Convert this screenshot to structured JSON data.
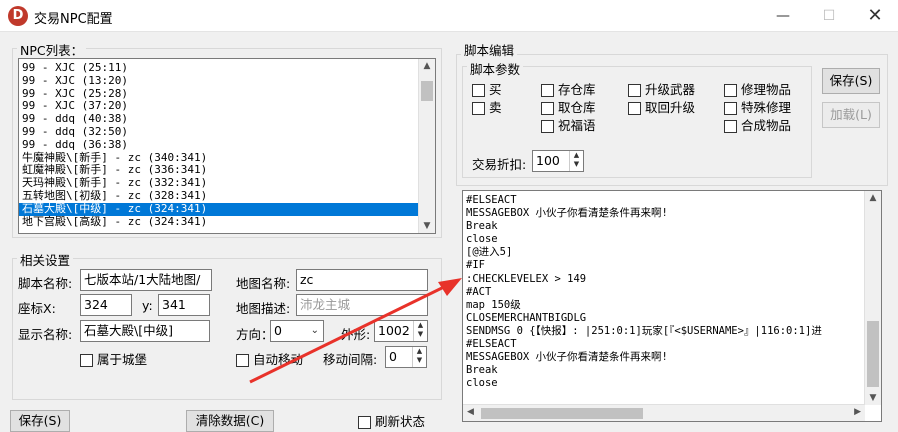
{
  "window": {
    "title": "交易NPC配置",
    "icon_letter": "D"
  },
  "npc_list": {
    "label": "NPC列表：",
    "items": [
      "99 - XJC (25:11)",
      "99 - XJC (13:20)",
      "99 - XJC (25:28)",
      "99 - XJC (37:20)",
      "99 - ddq (40:38)",
      "99 - ddq (32:50)",
      "99 - ddq (36:38)",
      "牛魔神殿\\[新手] - zc (340:341)",
      "虹魔神殿\\[新手] - zc (336:341)",
      "天玛神殿\\[新手] - zc (332:341)",
      "五转地图\\[初级] - zc (328:341)",
      "石墓大殿\\[中级] - zc (324:341)",
      "地下宫殿\\[高级] - zc (324:341)"
    ],
    "selected_index": 11
  },
  "settings": {
    "label": "相关设置",
    "script_name_label": "脚本名称:",
    "script_name_value": "七版本站/1大陆地图/",
    "coord_label": "座标X:",
    "coord_x": "324",
    "coord_y_label": "y:",
    "coord_y": "341",
    "display_name_label": "显示名称:",
    "display_name_value": "石墓大殿\\[中级]",
    "belongs_castle_label": "属于城堡",
    "map_name_label": "地图名称:",
    "map_name_value": "zc",
    "map_desc_label": "地图描述:",
    "map_desc_placeholder": "沛龙主城",
    "direction_label": "方向：",
    "direction_value": "0",
    "appearance_label": "外形:",
    "appearance_value": "1002",
    "auto_move_label": "自动移动",
    "move_interval_label": "移动间隔:",
    "move_interval_value": "0"
  },
  "script_editor": {
    "label": "脚本编辑",
    "params_label": "脚本参数",
    "checkboxes": {
      "buy": "买",
      "sell": "卖",
      "storage": "存仓库",
      "take_storage": "取仓库",
      "pray": "祝福语",
      "upgrade_weapon": "升级武器",
      "take_upgrade": "取回升级",
      "repair": "修理物品",
      "special_repair": "特殊修理",
      "combine": "合成物品"
    },
    "discount_label": "交易折扣:",
    "discount_value": "100",
    "save_button": "保存(S)",
    "load_button": "加载(L)",
    "code_lines": [
      "#ELSEACT",
      "MESSAGEBOX 小伙子你看清楚条件再来啊!",
      "Break",
      "close",
      "[@进入5]",
      "#IF",
      ":CHECKLEVELEX > 149",
      "#ACT",
      "map 150级",
      "CLOSEMERCHANTBIGDLG",
      "SENDMSG 0 {【快报】: |251:0:1]玩家[『<$USERNAME>』|116:0:1]进",
      "#ELSEACT",
      "MESSAGEBOX 小伙子你看清楚条件再来啊!",
      "Break",
      "close"
    ]
  },
  "bottom": {
    "save_button": "保存(S)",
    "clear_button": "清除数据(C)",
    "refresh_label": "刷新状态"
  },
  "colors": {
    "selection": "#0078d7",
    "arrow": "#e8322a",
    "app_icon": "#c0392b"
  }
}
